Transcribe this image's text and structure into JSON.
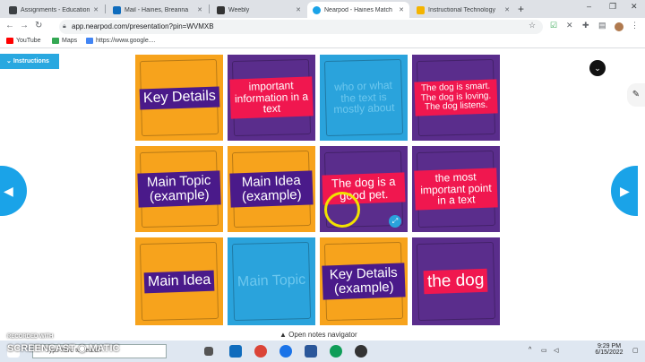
{
  "tabs": [
    {
      "label": "Assignments - Education",
      "fav_color": "#3c4043"
    },
    {
      "label": "Mail - Haines, Breanna",
      "fav_color": "#0f6cbd"
    },
    {
      "label": "Weebly",
      "fav_color": "#333333"
    },
    {
      "label": "Nearpod - Haines Match",
      "fav_color": "#1aa3e8"
    },
    {
      "label": "Instructional Technology",
      "fav_color": "#f4b400"
    }
  ],
  "new_tab_symbol": "+",
  "window_controls": [
    "–",
    "❐",
    "✕"
  ],
  "address": {
    "url": "app.nearpod.com/presentation?pin=WVMXB"
  },
  "bookmarks": [
    {
      "label": "YouTube",
      "color": "#ff0000"
    },
    {
      "label": "Maps",
      "color": "#34a853"
    },
    {
      "label": "https://www.google....",
      "color": "#4285f4"
    }
  ],
  "page": {
    "instructions_label": "Instructions",
    "prev_icon": "◀",
    "next_icon": "▶",
    "chevron_icon": "⌄",
    "side_icon": "✎",
    "expand_icon": "⤢"
  },
  "cards": [
    {
      "text": "Key Details",
      "bg": "orange",
      "banner": "purple",
      "size": 16
    },
    {
      "text": "important information in a text",
      "bg": "purple",
      "banner": "red",
      "size": 12
    },
    {
      "text": "who or what the text is mostly about",
      "bg": "blue",
      "banner": "blue",
      "size": 12
    },
    {
      "text": "The dog is smart. The dog is loving. The dog listens.",
      "bg": "purple",
      "banner": "red",
      "size": 10
    },
    {
      "text": "Main Topic (example)",
      "bg": "orange",
      "banner": "purple",
      "size": 15
    },
    {
      "text": "Main Idea (example)",
      "bg": "orange",
      "banner": "purple",
      "size": 15
    },
    {
      "text": "The dog is a good pet.",
      "bg": "purple",
      "banner": "red",
      "size": 13
    },
    {
      "text": "the most important point in a text",
      "bg": "purple",
      "banner": "red",
      "size": 12
    },
    {
      "text": "Main Idea",
      "bg": "orange",
      "banner": "purple",
      "size": 16
    },
    {
      "text": "Main Topic",
      "bg": "blue",
      "banner": "blue",
      "size": 16
    },
    {
      "text": "Key Details (example)",
      "bg": "orange",
      "banner": "purple",
      "size": 15
    },
    {
      "text": "the dog",
      "bg": "purple",
      "banner": "red",
      "size": 19
    }
  ],
  "notes_navigator": "▲ Open notes navigator",
  "watermark": {
    "line1": "RECORDED WITH",
    "line2": "SCREENCAST ◉ MATIC"
  },
  "taskbar": {
    "search_placeholder": "Type here to search",
    "time": "9:29 PM",
    "date": "6/15/2022"
  }
}
